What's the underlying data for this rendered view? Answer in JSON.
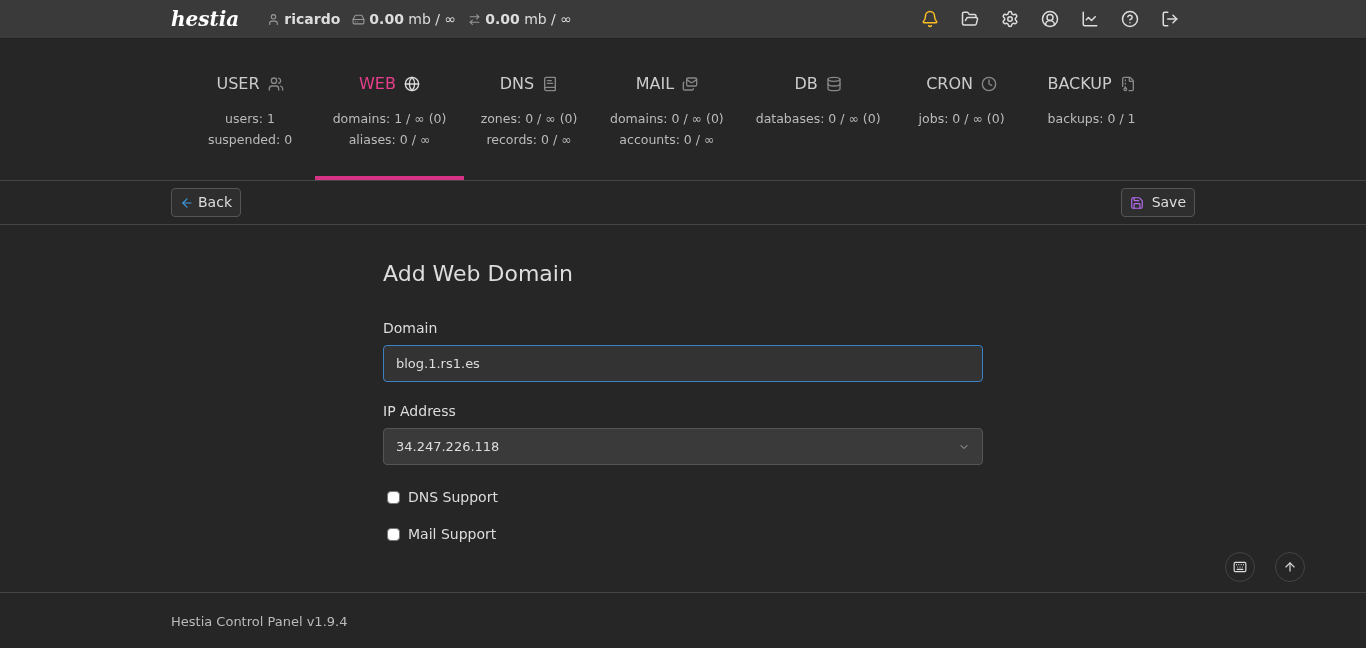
{
  "topbar": {
    "logo": "hestia",
    "user": "ricardo",
    "disk": {
      "value": "0.00",
      "unit": "mb / ∞"
    },
    "bandwidth": {
      "value": "0.00",
      "unit": "mb / ∞"
    }
  },
  "tabs": [
    {
      "label": "USER",
      "selected": false,
      "lines": [
        "users: 1",
        "suspended: 0"
      ]
    },
    {
      "label": "WEB",
      "selected": true,
      "lines": [
        "domains: 1 / ∞ (0)",
        "aliases: 0 / ∞"
      ]
    },
    {
      "label": "DNS",
      "selected": false,
      "lines": [
        "zones: 0 / ∞ (0)",
        "records: 0 / ∞"
      ]
    },
    {
      "label": "MAIL",
      "selected": false,
      "lines": [
        "domains: 0 / ∞ (0)",
        "accounts: 0 / ∞"
      ]
    },
    {
      "label": "DB",
      "selected": false,
      "lines": [
        "databases: 0 / ∞ (0)"
      ]
    },
    {
      "label": "CRON",
      "selected": false,
      "lines": [
        "jobs: 0 / ∞ (0)"
      ]
    },
    {
      "label": "BACKUP",
      "selected": false,
      "lines": [
        "backups: 0 / 1"
      ]
    }
  ],
  "toolbar": {
    "back": "Back",
    "save": "Save"
  },
  "form": {
    "title": "Add Web Domain",
    "domain": {
      "label": "Domain",
      "value": "blog.1.rs1.es"
    },
    "ip": {
      "label": "IP Address",
      "value": "34.247.226.118"
    },
    "options": [
      {
        "label": "DNS Support",
        "checked": false
      },
      {
        "label": "Mail Support",
        "checked": false
      }
    ]
  },
  "footer": "Hestia Control Panel v1.9.4"
}
